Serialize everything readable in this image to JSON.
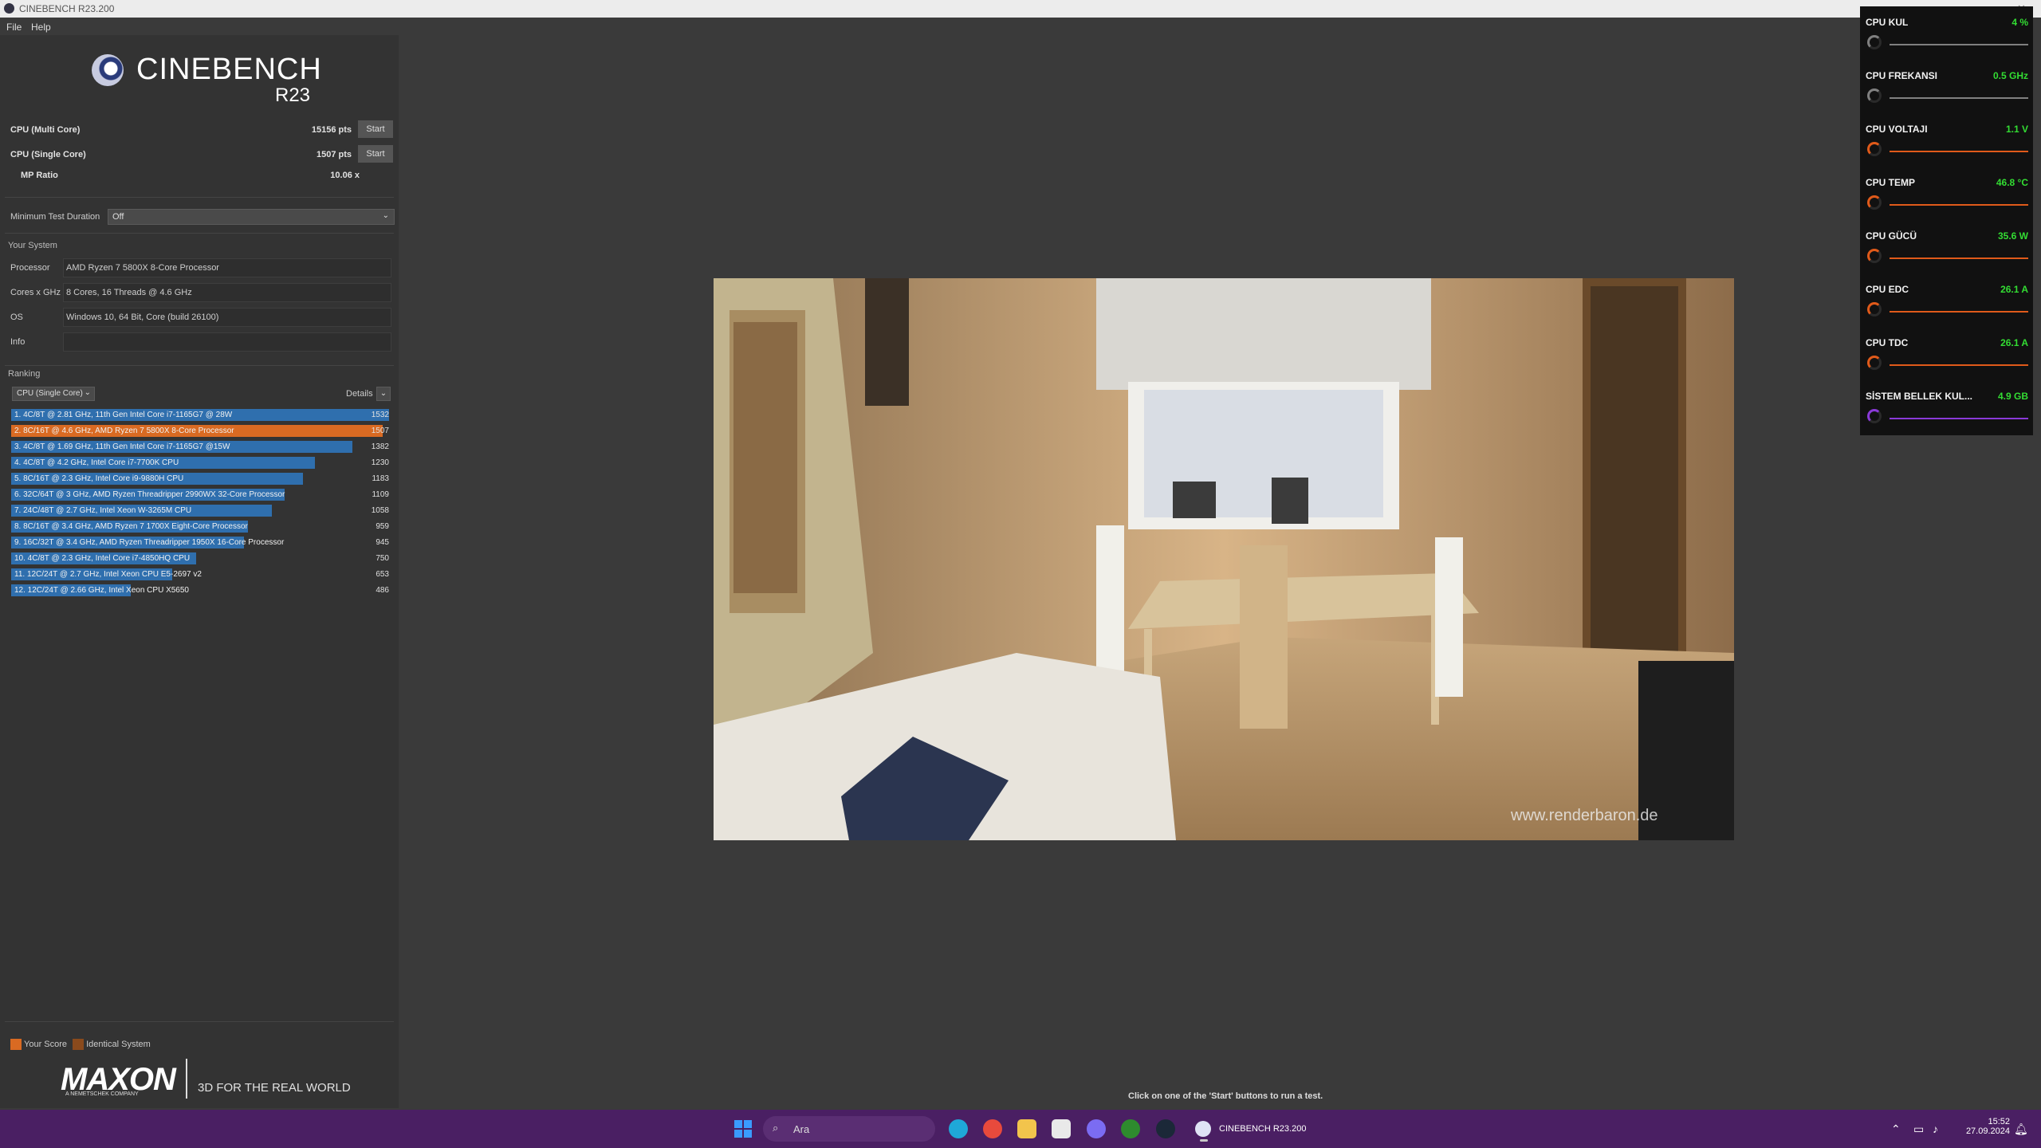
{
  "window": {
    "title": "CINEBENCH R23.200"
  },
  "menu": [
    "File",
    "Help"
  ],
  "logo": {
    "name": "CINEBENCH",
    "version": "R23"
  },
  "scores": {
    "multi": {
      "label": "CPU (Multi Core)",
      "pts": "15156 pts",
      "button": "Start"
    },
    "single": {
      "label": "CPU (Single Core)",
      "pts": "1507 pts",
      "button": "Start"
    },
    "mp": {
      "label": "MP Ratio",
      "value": "10.06 x"
    }
  },
  "duration": {
    "label": "Minimum Test Duration",
    "value": "Off"
  },
  "system": {
    "heading": "Your System",
    "rows": [
      {
        "key": "Processor",
        "value": "AMD Ryzen 7 5800X 8-Core Processor"
      },
      {
        "key": "Cores x GHz",
        "value": "8 Cores, 16 Threads @ 4.6 GHz"
      },
      {
        "key": "OS",
        "value": "Windows 10, 64 Bit, Core (build 26100)"
      },
      {
        "key": "Info",
        "value": ""
      }
    ]
  },
  "ranking": {
    "heading": "Ranking",
    "mode": "CPU (Single Core)",
    "details": "Details",
    "items": [
      {
        "label": "1. 4C/8T @ 2.81 GHz, 11th Gen Intel Core i7-1165G7 @ 28W",
        "score": 1532,
        "mine": false
      },
      {
        "label": "2. 8C/16T @ 4.6 GHz, AMD Ryzen 7 5800X 8-Core Processor",
        "score": 1507,
        "mine": true
      },
      {
        "label": "3. 4C/8T @ 1.69 GHz, 11th Gen Intel Core i7-1165G7 @15W",
        "score": 1382,
        "mine": false
      },
      {
        "label": "4. 4C/8T @ 4.2 GHz, Intel Core i7-7700K CPU",
        "score": 1230,
        "mine": false
      },
      {
        "label": "5. 8C/16T @ 2.3 GHz, Intel Core i9-9880H CPU",
        "score": 1183,
        "mine": false
      },
      {
        "label": "6. 32C/64T @ 3 GHz, AMD Ryzen Threadripper 2990WX 32-Core Processor",
        "score": 1109,
        "mine": false
      },
      {
        "label": "7. 24C/48T @ 2.7 GHz, Intel Xeon W-3265M CPU",
        "score": 1058,
        "mine": false
      },
      {
        "label": "8. 8C/16T @ 3.4 GHz, AMD Ryzen 7 1700X Eight-Core Processor",
        "score": 959,
        "mine": false
      },
      {
        "label": "9. 16C/32T @ 3.4 GHz, AMD Ryzen Threadripper 1950X 16-Core Processor",
        "score": 945,
        "mine": false
      },
      {
        "label": "10. 4C/8T @ 2.3 GHz, Intel Core i7-4850HQ CPU",
        "score": 750,
        "mine": false
      },
      {
        "label": "11. 12C/24T @ 2.7 GHz, Intel Xeon CPU E5-2697 v2",
        "score": 653,
        "mine": false
      },
      {
        "label": "12. 12C/24T @ 2.66 GHz, Intel Xeon CPU X5650",
        "score": 486,
        "mine": false
      }
    ]
  },
  "legend": {
    "yours": "Your Score",
    "identical": "Identical System",
    "yours_color": "#d96a22",
    "identical_color": "#8a4a1c"
  },
  "footer": {
    "brand": "MAXON",
    "brand_sub": "A NEMETSCHEK COMPANY",
    "tagline": "3D FOR THE REAL WORLD"
  },
  "render": {
    "watermark": "www.renderbaron.de"
  },
  "status": "Click on one of the 'Start' buttons to run a test.",
  "sensors": [
    {
      "name": "CPU KUL",
      "value": "4 %",
      "color": "#808080"
    },
    {
      "name": "CPU FREKANSI",
      "value": "0.5 GHz",
      "color": "#808080"
    },
    {
      "name": "CPU VOLTAJI",
      "value": "1.1 V",
      "color": "#e05a1a"
    },
    {
      "name": "CPU TEMP",
      "value": "46.8 °C",
      "color": "#e05a1a"
    },
    {
      "name": "CPU GÜCÜ",
      "value": "35.6 W",
      "color": "#e05a1a"
    },
    {
      "name": "CPU EDC",
      "value": "26.1 A",
      "color": "#e05a1a"
    },
    {
      "name": "CPU TDC",
      "value": "26.1 A",
      "color": "#e05a1a"
    },
    {
      "name": "SİSTEM BELLEK KUL...",
      "value": "4.9 GB",
      "color": "#8a3ad8"
    }
  ],
  "taskbar": {
    "search": "Ara",
    "running_app": "CINEBENCH R23.200",
    "time": "15:52",
    "date": "27.09.2024"
  }
}
